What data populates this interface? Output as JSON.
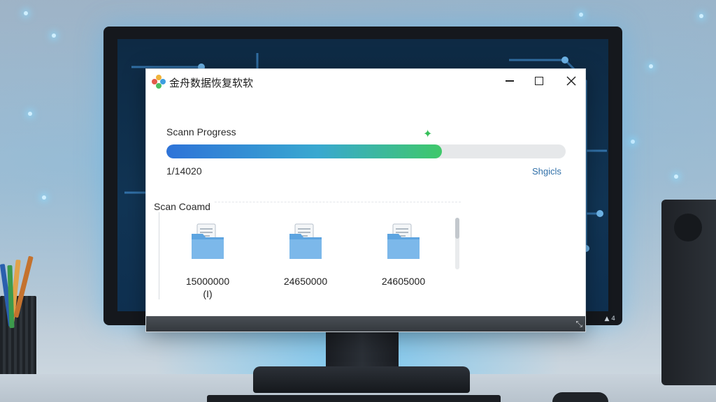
{
  "app": {
    "title": "金舟数据恢复软软",
    "window_controls": {
      "minimize_icon": "minimize-icon",
      "maximize_icon": "maximize-icon",
      "close_icon": "close-icon"
    }
  },
  "progress": {
    "label": "Scann Progress",
    "count": "1/14020",
    "link": "Shgicls",
    "percent": 69
  },
  "scan_panel": {
    "title": "Scan Coamd",
    "items": [
      {
        "name": "15000000",
        "sub": "(I)",
        "icon": "folder-document-icon"
      },
      {
        "name": "24650000",
        "sub": "",
        "icon": "folder-document-icon"
      },
      {
        "name": "24605000",
        "sub": "",
        "icon": "folder-document-icon"
      }
    ]
  },
  "monitor": {
    "brand": "▲ 4"
  },
  "colors": {
    "progress_start": "#2e73d8",
    "progress_end": "#3fc86a",
    "link": "#2f6fa8",
    "folder": "#5da4e0"
  }
}
